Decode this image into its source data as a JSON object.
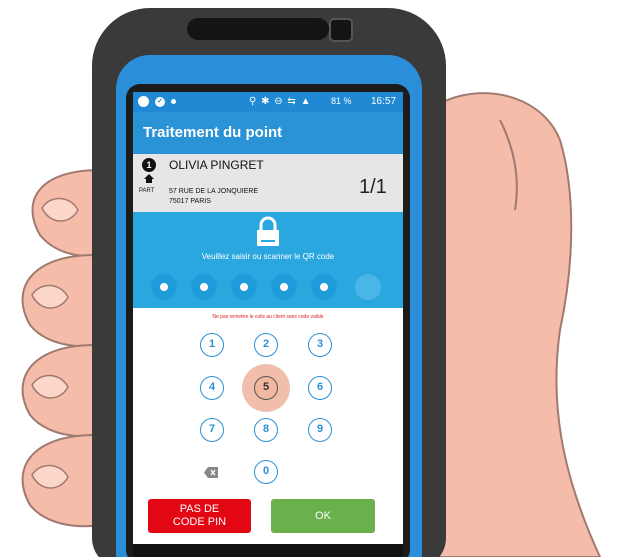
{
  "status_bar": {
    "icons": "⚲ ✱ ⊖ ⇆ ▲",
    "battery": "81 %",
    "time": "16:57"
  },
  "app_bar": {
    "title": "Traitement du point"
  },
  "stop_card": {
    "stop_number": "1",
    "client_name": "OLIVIA PINGRET",
    "type_label": "PART",
    "address_line1": "57 RUE DE LA JONQUIERE",
    "address_line2": "75017 PARIS",
    "progress": "1/1"
  },
  "qr_panel": {
    "instruction": "Veuillez saisir ou scanner le QR code",
    "pin_filled_count": 5,
    "pin_total": 6
  },
  "warning": "Ne pas remettre le colis au client sans code valide",
  "keypad": {
    "k1": "1",
    "k2": "2",
    "k3": "3",
    "k4": "4",
    "k5": "5",
    "k6": "6",
    "k7": "7",
    "k8": "8",
    "k9": "9",
    "k0": "0",
    "active_key": "5"
  },
  "buttons": {
    "no_pin_line1": "PAS DE",
    "no_pin_line2": "CODE PIN",
    "ok": "OK"
  },
  "colors": {
    "primary_blue": "#2a93d5",
    "qr_blue": "#2aa7df",
    "warning_red": "#e02020",
    "no_pin_red": "#e30613",
    "ok_green": "#6ab04c",
    "active_key_peach": "#f1b79f"
  }
}
